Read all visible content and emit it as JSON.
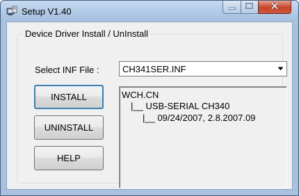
{
  "window": {
    "title": "Setup V1.40",
    "icons": {
      "app": "setup-app-icon",
      "minimize": "minimize-icon",
      "maximize": "maximize-icon",
      "close": "close-icon"
    }
  },
  "group": {
    "title": "Device Driver Install / UnInstall"
  },
  "inf": {
    "label": "Select INF File :",
    "selected": "CH341SER.INF",
    "dropdown_icon": "chevron-down-icon"
  },
  "buttons": {
    "install": "INSTALL",
    "uninstall": "UNINSTALL",
    "help": "HELP"
  },
  "driver_info": {
    "vendor": "WCH.CN",
    "device": "|__ USB-SERIAL CH340",
    "version": "|__ 09/24/2007, 2.8.2007.09"
  },
  "colors": {
    "close_button": "#c6452c",
    "focus_border": "#3c7fb1",
    "titlebar": "#b3cbe7"
  }
}
